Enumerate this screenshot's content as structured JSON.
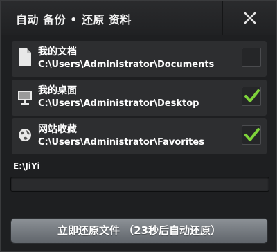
{
  "window": {
    "title": "自动 备份 • 还原 资料"
  },
  "items": [
    {
      "name": "我的文档",
      "path": "C:\\Users\\Administrator\\Documents",
      "checked": false,
      "icon": "document-icon"
    },
    {
      "name": "我的桌面",
      "path": "C:\\Users\\Administrator\\Desktop",
      "checked": true,
      "icon": "monitor-icon"
    },
    {
      "name": "网站收藏",
      "path": "C:\\Users\\Administrator\\Favorites",
      "checked": true,
      "icon": "globe-icon"
    }
  ],
  "destination": "E:\\JiYi",
  "progress": 0,
  "restore_button": "立即还原文件 （23秒后自动还原）",
  "colors": {
    "check": "#7ed33a",
    "background": "#1e1f21",
    "item_background": "#2d2e30"
  }
}
